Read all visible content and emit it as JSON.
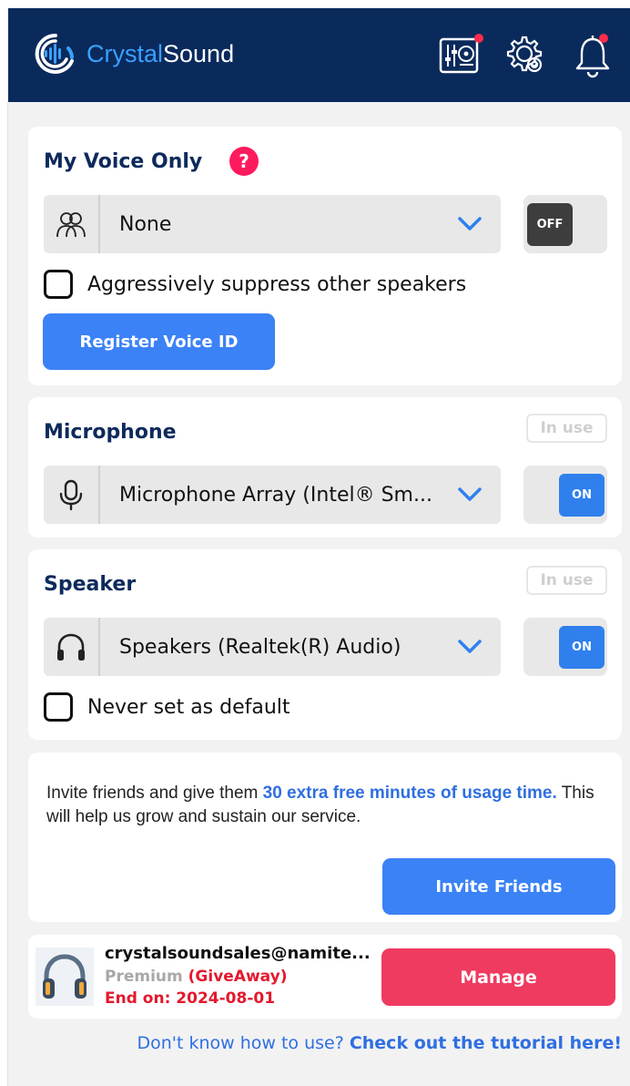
{
  "app": {
    "logo_crystal": "Crystal",
    "logo_sound": "Sound",
    "header_icons": [
      "mixer-icon",
      "gear-icon",
      "bell-icon"
    ]
  },
  "my_voice": {
    "title": "My Voice Only",
    "help_glyph": "?",
    "select_value": "None",
    "toggle_label": "OFF",
    "checkbox_label": "Aggressively suppress other speakers",
    "register_button": "Register Voice ID"
  },
  "microphone": {
    "title": "Microphone",
    "status": "In use",
    "select_value": "Microphone Array (Intel® Sm...",
    "toggle_label": "ON"
  },
  "speaker": {
    "title": "Speaker",
    "status": "In use",
    "select_value": "Speakers (Realtek(R) Audio)",
    "toggle_label": "ON",
    "checkbox_label": "Never set as default"
  },
  "invite": {
    "text_before": "Invite friends and give them ",
    "text_highlight": "30 extra free minutes of usage time.",
    "text_after": " This will help us grow and sustain our service.",
    "button": "Invite Friends"
  },
  "account": {
    "email": "crystalsoundsales@namite...",
    "plan": "Premium",
    "plan_note": "(GiveAway)",
    "end_on": "End on: 2024-08-01",
    "manage_button": "Manage"
  },
  "footer": {
    "question": "Don't know how to use? ",
    "link": "Check out the tutorial here!"
  },
  "colors": {
    "header_bg": "#0a2a5c",
    "accent_blue": "#3b82f6",
    "manage_red": "#ef3b60",
    "help_pink": "#ff1a5e",
    "title_navy": "#0d2a5c"
  }
}
